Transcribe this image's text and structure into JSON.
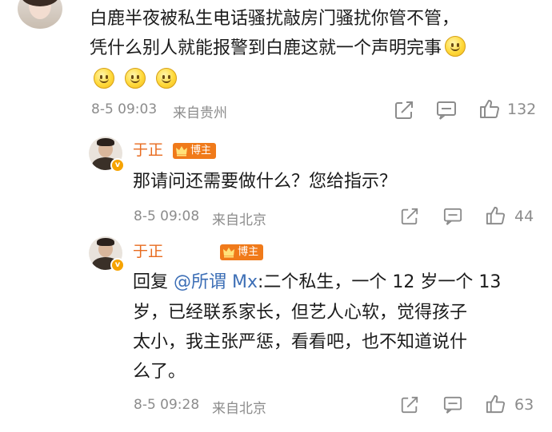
{
  "comments": [
    {
      "text_line1": "白鹿半夜被私生电话骚扰敲房门骚扰你管不管，",
      "text_line2": "凭什么别人就能报警到白鹿这就一个声明完事",
      "time": "8-5 09:03",
      "location": "来自贵州",
      "likes": "132"
    },
    {
      "author": "于正",
      "badge": "博主",
      "text": "那请问还需要做什么？您给指示？",
      "time": "8-5 09:08",
      "location": "来自北京",
      "likes": "44"
    },
    {
      "author": "于正",
      "badge": "博主",
      "reply_prefix": "回复",
      "mention": "@所谓 Mx",
      "text_line1": ":二个私生，一个 12 岁一个 13",
      "text_line2": "岁，已经联系家长，但艺人心软，觉得孩子",
      "text_line3": "太小，我主张严惩，看看吧，也不知道说什",
      "text_line4": "么了。",
      "time": "8-5 09:28",
      "location": "来自北京",
      "likes": "63"
    }
  ],
  "icons": {
    "share": "share-icon",
    "comment": "comment-icon",
    "like": "thumbs-up-icon",
    "emoji": "smile-emoji",
    "crown": "crown-icon"
  },
  "colors": {
    "author_name": "#e86b1f",
    "badge_bg": "#f07a1a",
    "mention": "#3d6fb6",
    "meta": "#8c8c8c"
  }
}
